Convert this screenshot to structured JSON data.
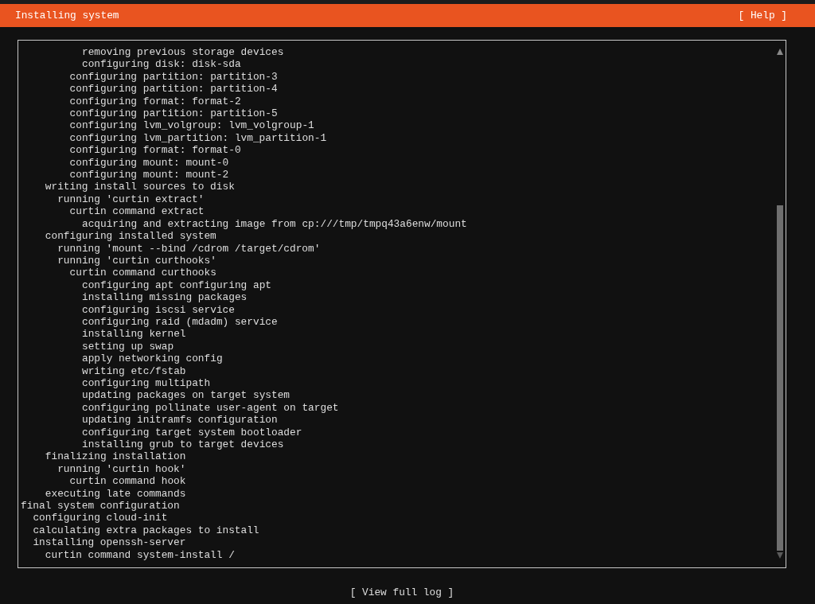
{
  "header": {
    "title": "Installing system",
    "help_button": "[ Help ]"
  },
  "log": {
    "entries": [
      {
        "children": [
          {
            "children": [
              {
                "children": [
                  {
                    "children": [
                      {
                        "children": [
                          {
                            "text": "removing previous storage devices"
                          },
                          {
                            "text": "configuring disk: disk-sda"
                          }
                        ]
                      },
                      {
                        "text": "configuring partition: partition-3"
                      },
                      {
                        "text": "configuring partition: partition-4"
                      },
                      {
                        "text": "configuring format: format-2"
                      },
                      {
                        "text": "configuring partition: partition-5"
                      },
                      {
                        "text": "configuring lvm_volgroup: lvm_volgroup-1"
                      },
                      {
                        "text": "configuring lvm_partition: lvm_partition-1"
                      },
                      {
                        "text": "configuring format: format-0"
                      },
                      {
                        "text": "configuring mount: mount-0"
                      },
                      {
                        "text": "configuring mount: mount-2"
                      }
                    ]
                  }
                ]
              },
              {
                "text": "writing install sources to disk",
                "children": [
                  {
                    "text": "running 'curtin extract'",
                    "children": [
                      {
                        "text": "curtin command extract",
                        "children": [
                          {
                            "text": "acquiring and extracting image from cp:///tmp/tmpq43a6enw/mount"
                          }
                        ]
                      }
                    ]
                  }
                ]
              },
              {
                "text": "configuring installed system",
                "children": [
                  {
                    "text": "running 'mount --bind /cdrom /target/cdrom'"
                  },
                  {
                    "text": "running 'curtin curthooks'",
                    "children": [
                      {
                        "text": "curtin command curthooks",
                        "children": [
                          {
                            "text": "configuring apt configuring apt"
                          },
                          {
                            "text": "installing missing packages"
                          },
                          {
                            "text": "configuring iscsi service"
                          },
                          {
                            "text": "configuring raid (mdadm) service"
                          },
                          {
                            "text": "installing kernel"
                          },
                          {
                            "text": "setting up swap"
                          },
                          {
                            "text": "apply networking config"
                          },
                          {
                            "text": "writing etc/fstab"
                          },
                          {
                            "text": "configuring multipath"
                          },
                          {
                            "text": "updating packages on target system"
                          },
                          {
                            "text": "configuring pollinate user-agent on target"
                          },
                          {
                            "text": "updating initramfs configuration"
                          },
                          {
                            "text": "configuring target system bootloader"
                          },
                          {
                            "text": "installing grub to target devices"
                          }
                        ]
                      }
                    ]
                  }
                ]
              },
              {
                "text": "finalizing installation",
                "children": [
                  {
                    "text": "running 'curtin hook'",
                    "children": [
                      {
                        "text": "curtin command hook"
                      }
                    ]
                  }
                ]
              },
              {
                "text": "executing late commands"
              }
            ]
          }
        ]
      },
      {
        "text": "final system configuration",
        "children": [
          {
            "text": "configuring cloud-init"
          },
          {
            "text": "calculating extra packages to install"
          },
          {
            "text": "installing openssh-server",
            "children": [
              {
                "text": "curtin command system-install /"
              }
            ]
          }
        ]
      }
    ]
  },
  "view_log_button": "[ View full log ]"
}
